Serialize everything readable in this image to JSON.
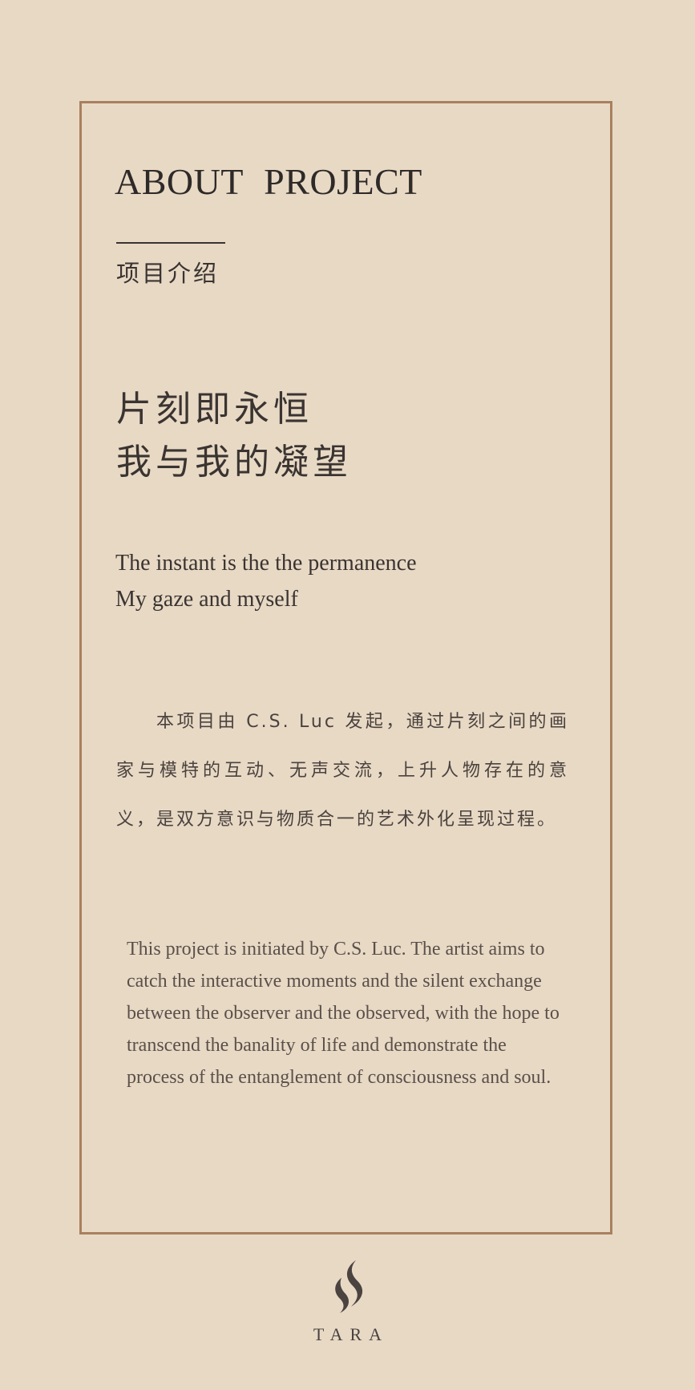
{
  "card": {
    "heading": "ABOUT  PROJECT",
    "subtitle": "项目介绍",
    "tagline_cn": [
      "片刻即永恒",
      "我与我的凝望"
    ],
    "tagline_en": [
      "The instant is the the permanence",
      "My gaze and myself"
    ],
    "description_cn": "本项目由 C.S. Luc 发起，通过片刻之间的画家与模特的互动、无声交流，上升人物存在的意义，是双方意识与物质合一的艺术外化呈现过程。",
    "description_en": "This project is initiated by C.S. Luc. The artist aims to catch the interactive moments and the silent exchange between the observer and the observed, with the hope to transcend the banality of life and demonstrate the process of the entanglement of consciousness and soul."
  },
  "footer": {
    "logo_icon": "tara-flame-logo-icon",
    "brand": "TARA"
  },
  "colors": {
    "background": "#e8d9c5",
    "frame_border": "#a8805e",
    "text": "#3a3431"
  }
}
